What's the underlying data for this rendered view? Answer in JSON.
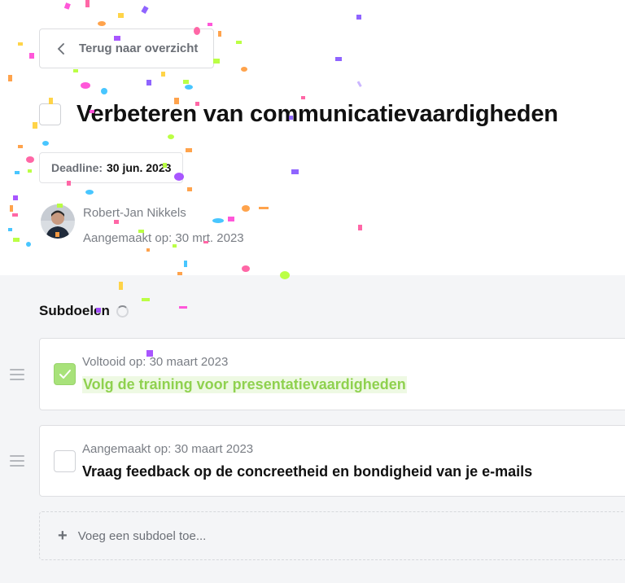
{
  "back": {
    "label": "Terug naar overzicht"
  },
  "goal": {
    "title": "Verbeteren van communicatievaardigheden",
    "checked": false
  },
  "deadline": {
    "label": "Deadline:",
    "value": "30 jun. 2023"
  },
  "author": {
    "name": "Robert-Jan Nikkels",
    "created": "Aangemaakt op: 30 mrt. 2023"
  },
  "subgoals": {
    "title": "Subdoelen",
    "items": [
      {
        "meta": "Voltooid op: 30 maart 2023",
        "text": "Volg de training voor presentatievaardigheden",
        "done": true
      },
      {
        "meta": "Aangemaakt op: 30 maart 2023",
        "text": "Vraag feedback op de concreetheid en bondigheid van je e-mails",
        "done": false
      }
    ],
    "add_label": "Voeg een subdoel toe..."
  },
  "colors": {
    "accent_green": "#a8e27a",
    "done_text": "#8fd14f",
    "background_lower": "#f4f5f7"
  }
}
